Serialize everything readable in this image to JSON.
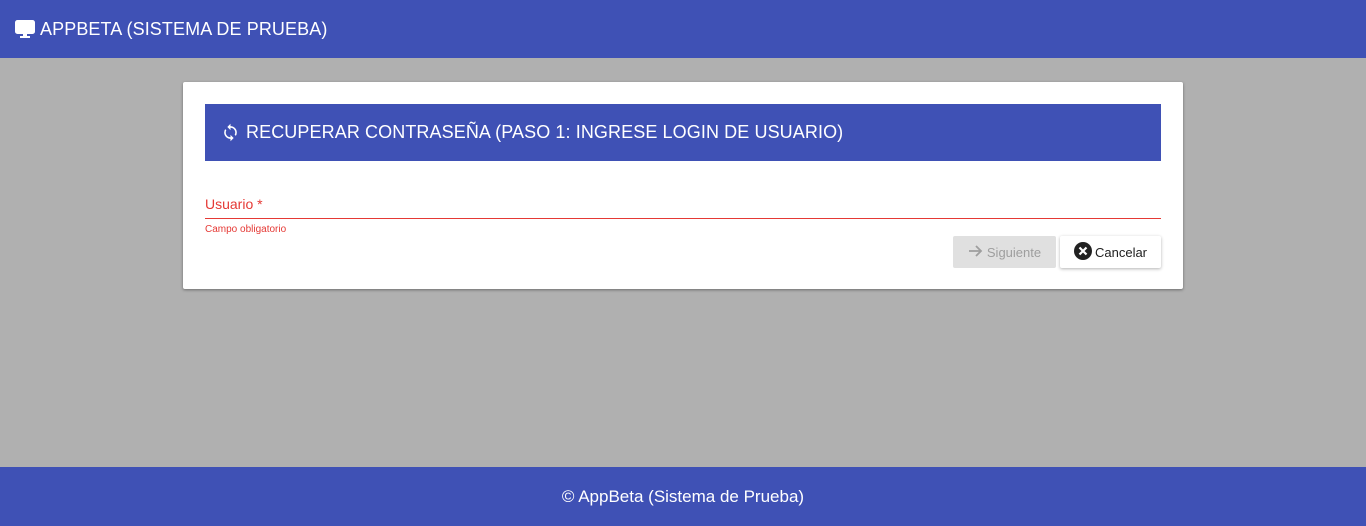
{
  "header": {
    "app_title": "APPBETA (SISTEMA DE PRUEBA)",
    "icon": "monitor-icon"
  },
  "form": {
    "title": "RECUPERAR CONTRASEÑA (PASO 1: INGRESE LOGIN DE USUARIO)",
    "title_icon": "refresh-icon",
    "username_label": "Usuario *",
    "username_value": "",
    "username_error": "Campo obligatorio",
    "next_label": "Siguiente",
    "cancel_label": "Cancelar"
  },
  "footer": {
    "text": "© AppBeta (Sistema de Prueba)"
  },
  "colors": {
    "primary": "#3f51b5",
    "error": "#e53935",
    "background": "#b0b0b0",
    "disabled_button": "#e0e0e0"
  }
}
